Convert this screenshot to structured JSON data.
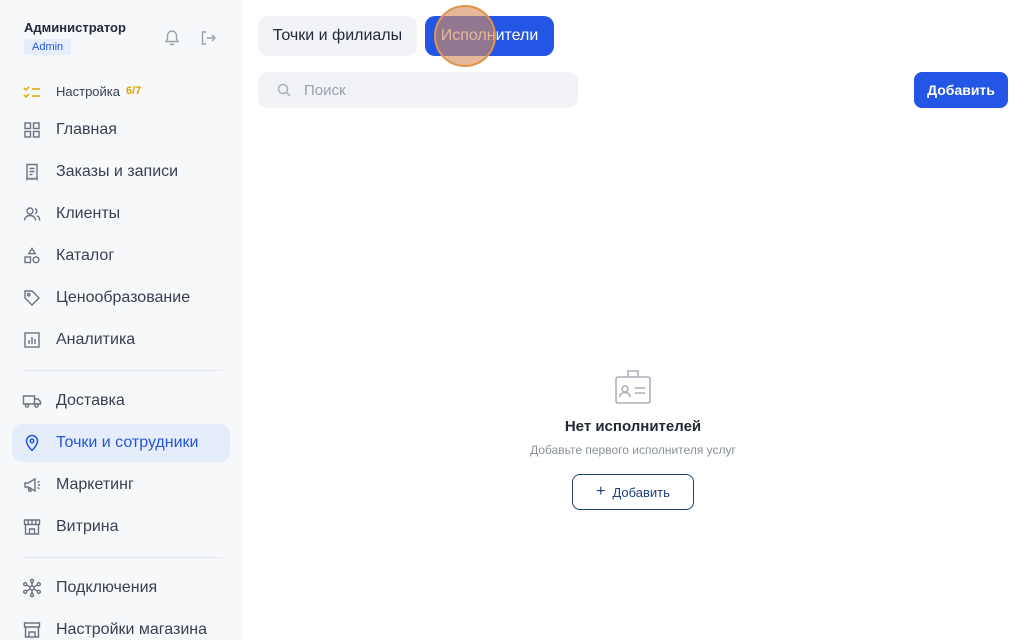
{
  "user": {
    "name": "Администратор",
    "role": "Admin"
  },
  "sidebar": {
    "setup": {
      "label": "Настройка",
      "count": "6/7"
    },
    "items": [
      {
        "label": "Главная",
        "icon": "grid-icon"
      },
      {
        "label": "Заказы и записи",
        "icon": "receipt-icon"
      },
      {
        "label": "Клиенты",
        "icon": "users-icon"
      },
      {
        "label": "Каталог",
        "icon": "shapes-icon"
      },
      {
        "label": "Ценообразование",
        "icon": "tag-icon"
      },
      {
        "label": "Аналитика",
        "icon": "chart-icon"
      },
      {
        "label": "Доставка",
        "icon": "truck-icon"
      },
      {
        "label": "Точки и сотрудники",
        "icon": "location-pin-icon",
        "active": true
      },
      {
        "label": "Маркетинг",
        "icon": "megaphone-icon"
      },
      {
        "label": "Витрина",
        "icon": "storefront-icon"
      },
      {
        "label": "Подключения",
        "icon": "network-icon"
      },
      {
        "label": "Настройки магазина",
        "icon": "shop-settings-icon"
      }
    ]
  },
  "tabs": [
    {
      "label": "Точки и филиалы",
      "active": false
    },
    {
      "label": "Исполнители",
      "active": true
    }
  ],
  "search": {
    "placeholder": "Поиск",
    "value": ""
  },
  "toolbar": {
    "add_label": "Добавить"
  },
  "empty_state": {
    "title": "Нет исполнителей",
    "subtitle": "Добавьте первого исполнителя услуг",
    "button_label": "Добавить",
    "icon": "id-badge-icon"
  },
  "colors": {
    "accent": "#2456e6",
    "setup_count": "#e0a400",
    "active_bg": "#e5ecfa"
  }
}
